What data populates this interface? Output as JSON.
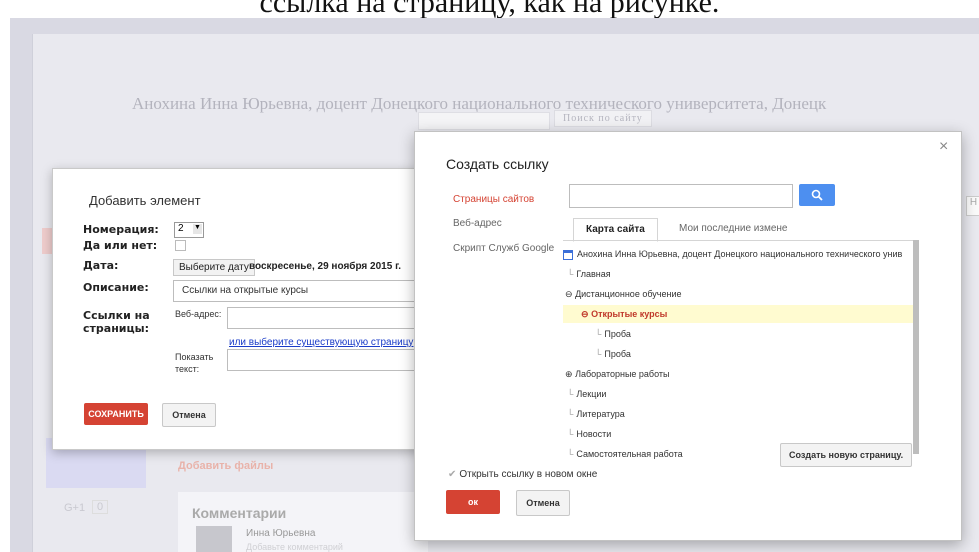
{
  "top_caption": "ссылка на страницу, как на рисунке.",
  "site": {
    "title": "Анохина Инна Юрьевна, доцент Донецкого национального технического университета, Донецк",
    "search_button": "Поиск по сайту",
    "attach_files": "Добавить файлы",
    "gplus": "G+1",
    "gplus_count": "0",
    "right_tab": "Н"
  },
  "comments": {
    "title": "Комментарии",
    "author": "Инна Юрьевна",
    "placeholder": "Добавьте комментарий"
  },
  "add_dialog": {
    "title": "Добавить элемент",
    "numbering_label": "Номерация:",
    "numbering_value": "2",
    "yes_no_label": "Да или нет:",
    "date_label": "Дата:",
    "date_button": "Выберите дату",
    "date_value": "воскресенье, 29 ноября 2015 г.",
    "description_label": "Описание:",
    "description_value": "Ссылки на открытые курсы",
    "links_label_line1": "Ссылки на",
    "links_label_line2": "страницы:",
    "web_address_label": "Веб-адрес:",
    "existing_page_link": "или выберите существующую страницу",
    "show_text_label_line1": "Показать",
    "show_text_label_line2": "текст:",
    "save_button": "СОХРАНИТЬ",
    "cancel_button": "Отмена"
  },
  "link_dialog": {
    "title": "Создать ссылку",
    "close": "×",
    "sidebar": [
      {
        "label": "Страницы сайтов",
        "active": true
      },
      {
        "label": "Веб-адрес",
        "active": false
      },
      {
        "label": "Скрипт Служб Google",
        "active": false
      }
    ],
    "tabs": [
      "Карта сайта",
      "Мои последние измене"
    ],
    "tree": [
      {
        "label": "Анохина Инна Юрьевна, доцент Донецкого национального технического унив",
        "level": 0,
        "icon": "page-icon"
      },
      {
        "label": "Главная",
        "level": 0,
        "icon": "elbow"
      },
      {
        "label": "Дистанционное обучение",
        "level": 0,
        "icon": "collapse-icon"
      },
      {
        "label": "Открытые курсы",
        "level": 1,
        "icon": "collapse-icon",
        "selected": true
      },
      {
        "label": "Проба",
        "level": 2,
        "icon": "elbow"
      },
      {
        "label": "Проба",
        "level": 2,
        "icon": "elbow"
      },
      {
        "label": "Лабораторные работы",
        "level": 0,
        "icon": "expand-icon"
      },
      {
        "label": "Лекции",
        "level": 0,
        "icon": "elbow"
      },
      {
        "label": "Литература",
        "level": 0,
        "icon": "elbow"
      },
      {
        "label": "Новости",
        "level": 0,
        "icon": "elbow"
      },
      {
        "label": "Самостоятельная работа",
        "level": 0,
        "icon": "elbow"
      }
    ],
    "new_page_button": "Создать новую страницу.",
    "open_new_window": "Открыть ссылку в новом окне",
    "ok_button": "ок",
    "cancel_button": "Отмена"
  },
  "colors": {
    "accent_red": "#d54333",
    "search_blue": "#4d8ff0",
    "link_blue": "#1a3cc8",
    "selected_bg": "#fffbd0"
  }
}
